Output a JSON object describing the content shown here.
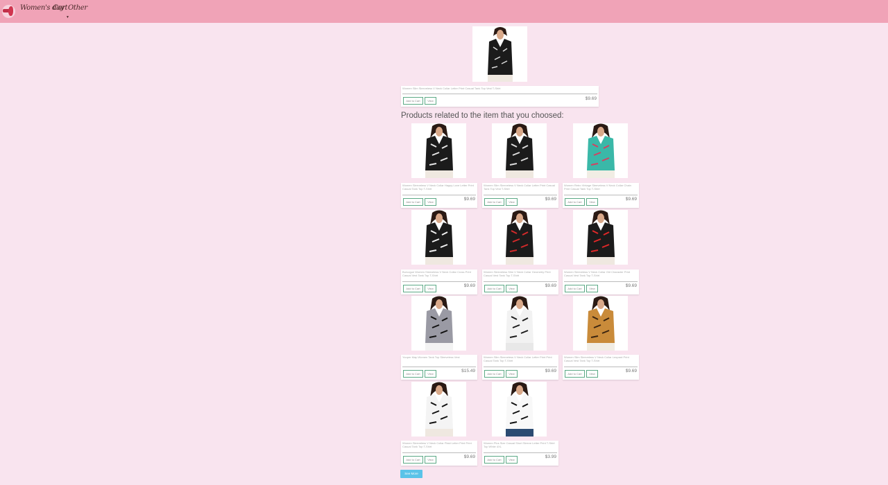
{
  "nav": {
    "logo_icon": "logo-icon",
    "links": [
      "Women's day",
      "Cart",
      "Other"
    ]
  },
  "colors": {
    "navbar": "#f0a3b7",
    "background": "#f9e4ef",
    "button_border": "#5ba985",
    "see_more": "#5ac3e8"
  },
  "hero": {
    "title": "Women Slim Sleeveless V Neck Collar Letter Print Casual Tank Top Vest T-Shirt",
    "price": "$9.69",
    "add_label": "Add to Cart",
    "view_label": "View"
  },
  "related_heading": "Products related to the item that you choosed:",
  "products": [
    {
      "title": "Women Sleeveless V Neck Collar Happy Love Letter Print Casual Tank Top T-Shirt",
      "price": "$9.69",
      "add_label": "Add to Cart",
      "view_label": "View"
    },
    {
      "title": "Women Slim Sleeveless V Neck Collar Letter Print Casual Tank Top Vest T-Shirt",
      "price": "$9.69",
      "add_label": "Add to Cart",
      "view_label": "View"
    },
    {
      "title": "Women Retro Vintage Sleeveless V Neck Collar Chain Print Casual Tank Top T-Shirt",
      "price": "$9.69",
      "add_label": "Add to Cart",
      "view_label": "View"
    },
    {
      "title": "Burvogue Women Sleeveless V Neck Collar Cross Print Casual Vest Tank Top T-Shirt",
      "price": "$9.69",
      "add_label": "Add to Cart",
      "view_label": "View"
    },
    {
      "title": "Women Sleeveless Slim V Neck Collar Geometry Print Casual Vest Tank Top T-Shirt",
      "price": "$9.69",
      "add_label": "Add to Cart",
      "view_label": "View"
    },
    {
      "title": "Women Sleeveless V Neck Collar Girl Character Print Casual Vest Tank Top T-Shirt",
      "price": "$9.69",
      "add_label": "Add to Cart",
      "view_label": "View"
    },
    {
      "title": "Yooper Map Women Tank Top Sleeveless Vest",
      "price": "$15.49",
      "add_label": "Add to Cart",
      "view_label": "View"
    },
    {
      "title": "Women Slim Sleeveless V Neck Collar Letter Print Print Casual Tank Top T-Shirt",
      "price": "$9.69",
      "add_label": "Add to Cart",
      "view_label": "View"
    },
    {
      "title": "Women Slim Sleeveless V Neck Collar Leopard Print Casual Vest Tank Top T-Shirt",
      "price": "$9.69",
      "add_label": "Add to Cart",
      "view_label": "View"
    },
    {
      "title": "Women Sleeveless V Neck Collar Plaid Letter Print Print Casual Tank Top T-Shirt",
      "price": "$9.69",
      "add_label": "Add to Cart",
      "view_label": "View"
    },
    {
      "title": "Women Plus Size Casual Short Sleeve Letter Print T-Shirt Top White 4XL",
      "price": "$3.99",
      "add_label": "Add to Cart",
      "view_label": "View"
    }
  ],
  "see_more_label": "See More"
}
